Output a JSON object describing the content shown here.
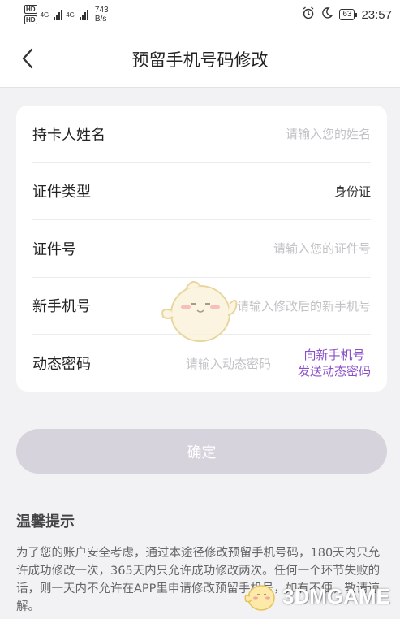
{
  "status_bar": {
    "hd1": "HD",
    "hd2": "HD",
    "net1": "4G",
    "net2": "4G",
    "speed_value": "743",
    "speed_unit": "B/s",
    "battery": "63",
    "time": "23:57"
  },
  "nav": {
    "title": "预留手机号码修改"
  },
  "form": {
    "holder_name": {
      "label": "持卡人姓名",
      "placeholder": "请输入您的姓名"
    },
    "id_type": {
      "label": "证件类型",
      "value": "身份证"
    },
    "id_number": {
      "label": "证件号",
      "placeholder": "请输入您的证件号"
    },
    "new_phone": {
      "label": "新手机号",
      "placeholder": "请输入修改后的新手机号"
    },
    "otp": {
      "label": "动态密码",
      "placeholder": "请输入动态密码",
      "send_line1": "向新手机号",
      "send_line2": "发送动态密码"
    }
  },
  "confirm_label": "确定",
  "tips": {
    "title": "温馨提示",
    "text": "为了您的账户安全考虑，通过本途径修改预留手机号码，180天内只允许成功修改一次，365天内只允许成功修改两次。任何一个环节失败的话，则一天内不允许在APP里申请修改预留手机号，如有不便，敬请谅解。"
  },
  "watermark": {
    "text": "3DMGAME"
  },
  "colors": {
    "accent": "#8a4fc8",
    "confirm_disabled": "#d6d3dc"
  }
}
